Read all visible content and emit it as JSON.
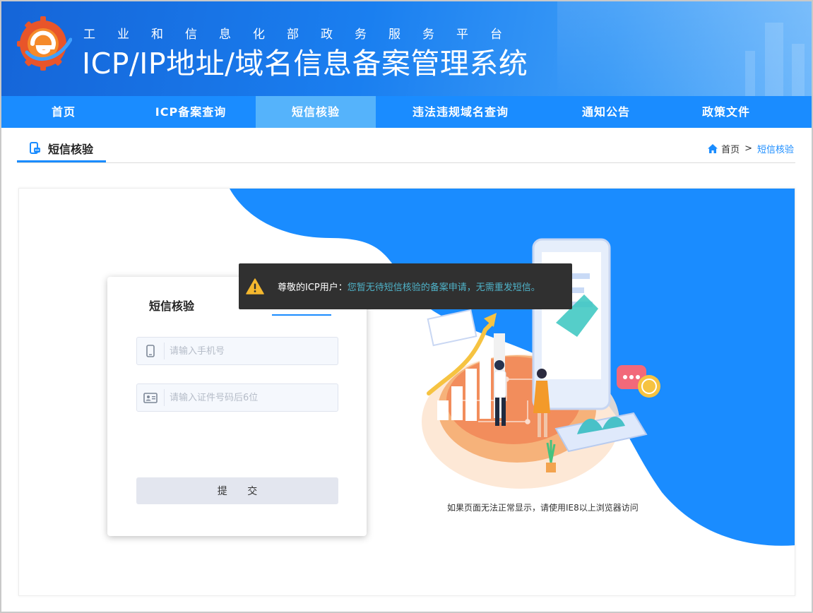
{
  "header": {
    "subtitle": "工业和信息化部政务服务平台",
    "title": "ICP/IP地址/域名信息备案管理系统"
  },
  "nav": {
    "items": [
      {
        "label": "首页"
      },
      {
        "label": "ICP备案查询"
      },
      {
        "label": "短信核验",
        "active": true
      },
      {
        "label": "违法违规域名查询"
      },
      {
        "label": "通知公告"
      },
      {
        "label": "政策文件"
      }
    ]
  },
  "page": {
    "tab_label": "短信核验",
    "breadcrumb": {
      "home": "首页",
      "separator": ">",
      "current": "短信核验"
    }
  },
  "form": {
    "tab_label": "短信核验",
    "phone_placeholder": "请输入手机号",
    "id_placeholder": "请输入证件号码后6位",
    "submit_label": "提 交"
  },
  "illustration": {
    "note": "如果页面无法正常显示，请使用IE8以上浏览器访问"
  },
  "toast": {
    "prefix": "尊敬的ICP用户：",
    "message": "您暂无待短信核验的备案申请，无需重发短信。"
  },
  "colors": {
    "primary": "#1a8cff",
    "nav_active": "#55b3fb",
    "toast_bg": "#303030",
    "toast_highlight": "#4fb3c9",
    "warning": "#f5b82e"
  }
}
